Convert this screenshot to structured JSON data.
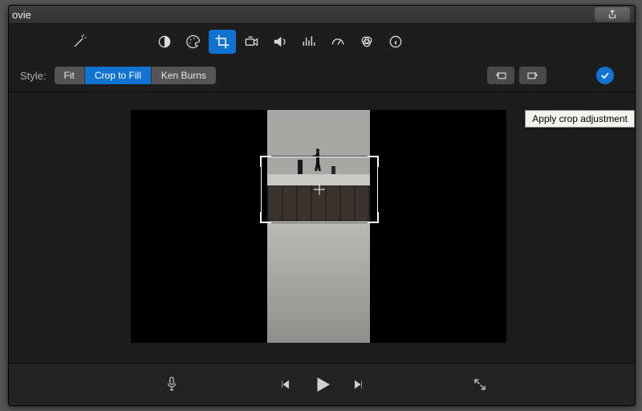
{
  "titlebar": {
    "title": "ovie"
  },
  "toolbar": {
    "icons": {
      "wand": "magic-wand-icon",
      "contrast": "contrast-icon",
      "palette": "color-palette-icon",
      "crop": "crop-icon",
      "camera": "camera-icon",
      "volume": "volume-icon",
      "eq": "equalizer-icon",
      "gauge": "speed-gauge-icon",
      "filters": "color-filters-icon",
      "info": "info-icon"
    },
    "active": "crop"
  },
  "style": {
    "label": "Style:",
    "options": [
      "Fit",
      "Crop to Fill",
      "Ken Burns"
    ],
    "selected": "Crop to Fill"
  },
  "rotation": {
    "ccw": "rotate-ccw-icon",
    "cw": "rotate-cw-icon"
  },
  "apply": {
    "icon": "checkmark-icon",
    "tooltip": "Apply crop adjustment"
  },
  "playback": {
    "mic": "microphone-icon",
    "prev": "previous-frame-icon",
    "play": "play-icon",
    "next": "next-frame-icon",
    "fullscreen": "fullscreen-icon"
  },
  "share": {
    "icon": "share-icon"
  },
  "colors": {
    "accent": "#1173d1"
  }
}
